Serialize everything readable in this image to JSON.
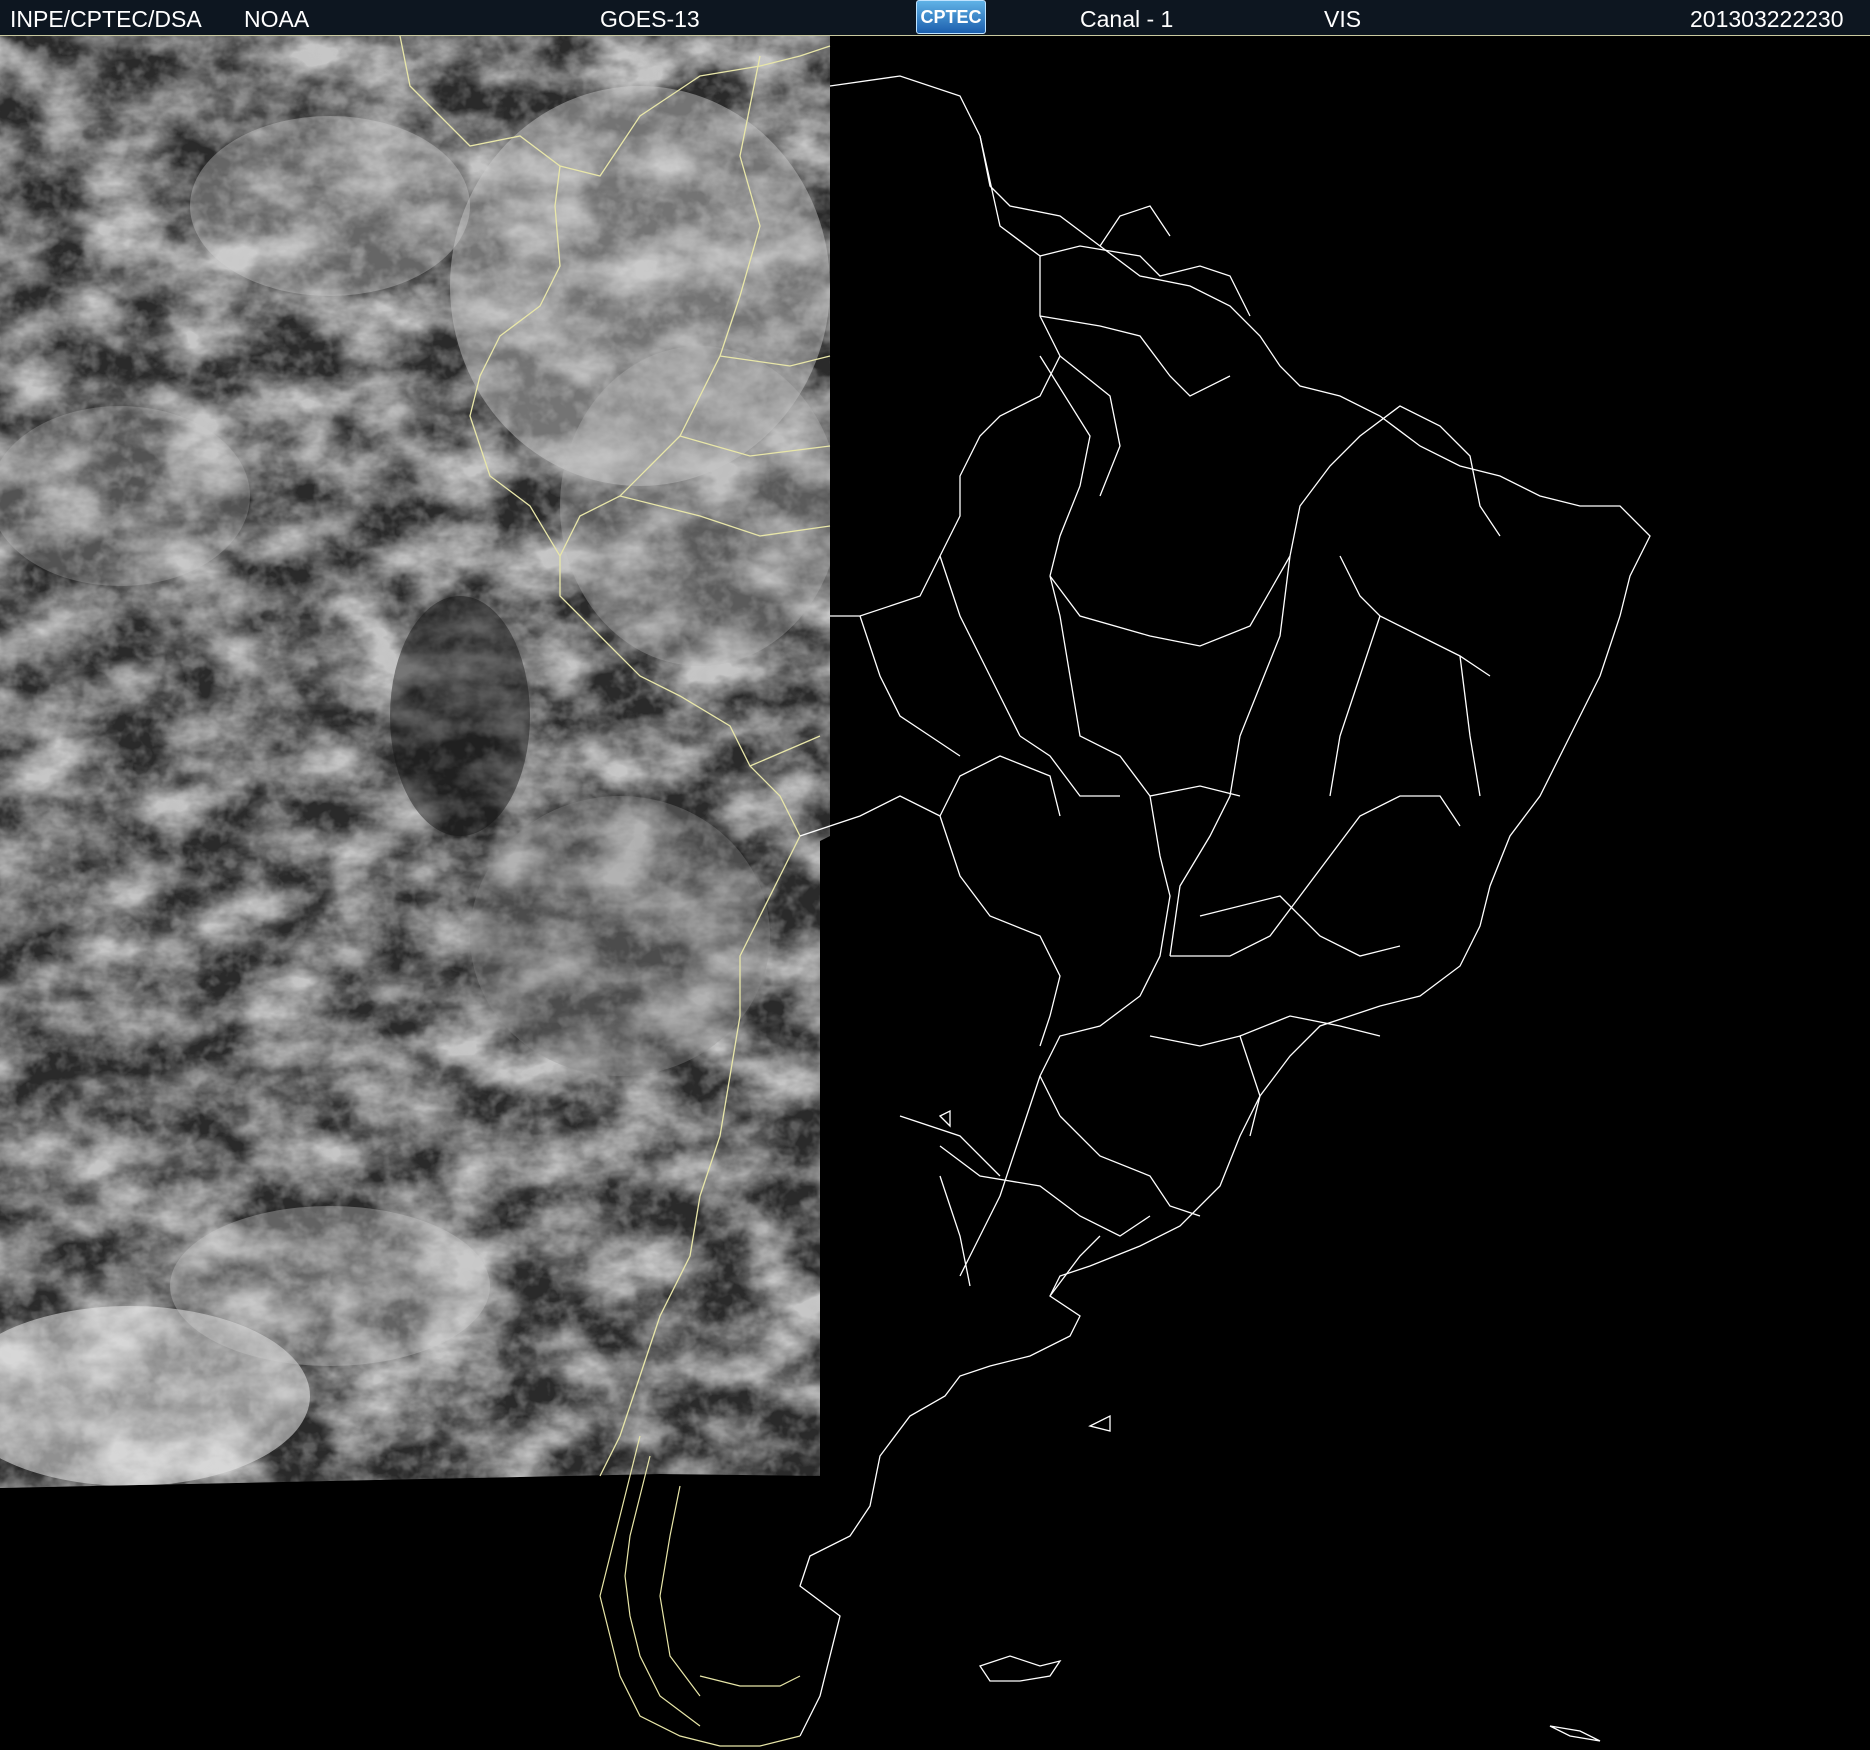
{
  "header": {
    "agency": "INPE/CPTEC/DSA",
    "source": "NOAA",
    "satellite": "GOES-13",
    "logo_text": "CPTEC",
    "channel": "Canal - 1",
    "band": "VIS",
    "timestamp": "201303222230"
  },
  "map": {
    "background_color": "#000000",
    "border_color_lit": "#e8e6a8",
    "border_color_dark": "#ffffff",
    "cloud_colors": [
      "#1c1c1c",
      "#5a5a5a",
      "#9a9a9a",
      "#d8d8d8"
    ]
  }
}
